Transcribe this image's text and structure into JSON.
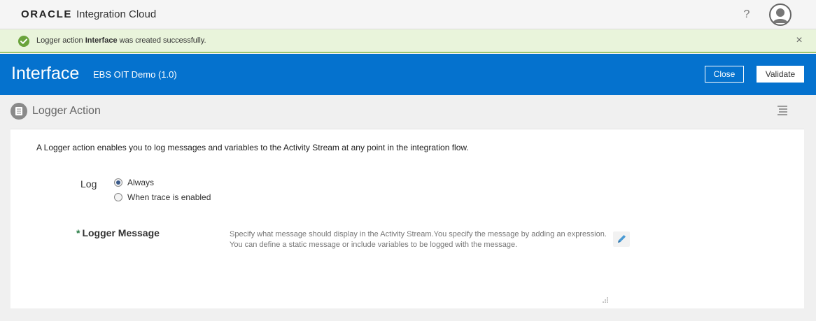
{
  "app": {
    "brand": "ORACLE",
    "product": "Integration Cloud",
    "help_glyph": "?"
  },
  "banner": {
    "prefix": "Logger action ",
    "name": "Interface",
    "suffix": " was created successfully.",
    "close_glyph": "×",
    "accent": "#6aa33c"
  },
  "header": {
    "title": "Interface",
    "subtitle": "EBS OIT Demo (1.0)",
    "close_label": "Close",
    "validate_label": "Validate",
    "color": "#0572ce"
  },
  "section": {
    "title": "Logger Action"
  },
  "content": {
    "description": "A Logger action enables you to log messages and variables to the Activity Stream at any point in the integration flow.",
    "log": {
      "label": "Log",
      "options": [
        {
          "label": "Always",
          "selected": true
        },
        {
          "label": "When trace is enabled",
          "selected": false
        }
      ]
    },
    "logger_message": {
      "required_mark": "*",
      "label": "Logger Message",
      "help": "Specify what message should display in the Activity Stream.You specify the message by adding an expression. You can define a static message or include variables to be logged with the message."
    }
  }
}
